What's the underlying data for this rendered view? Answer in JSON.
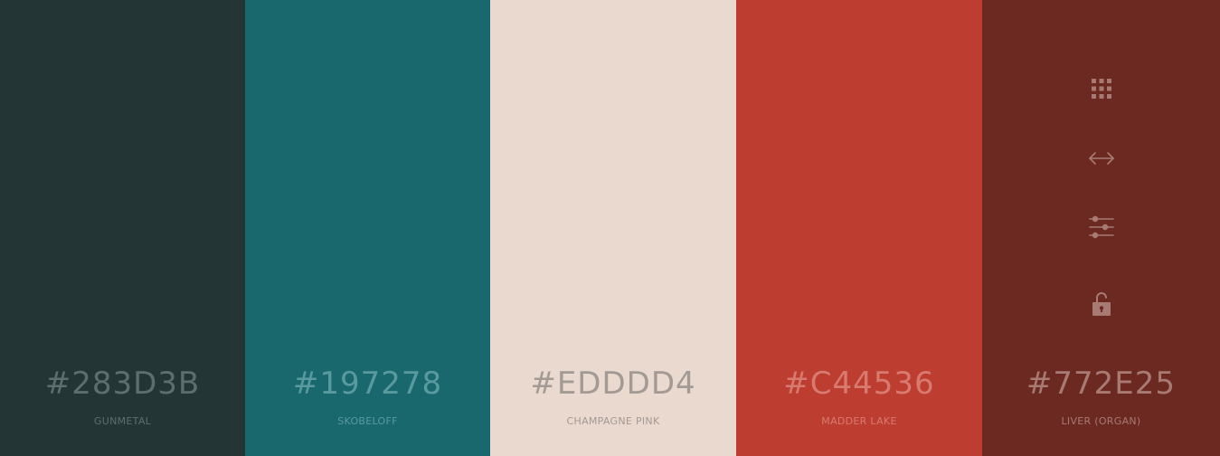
{
  "swatches": [
    {
      "hex": "#283D3B",
      "name": "GUNMETAL",
      "bg": "#233635",
      "text_color": "#5e6e6c"
    },
    {
      "hex": "#197278",
      "name": "SKOBELOFF",
      "bg": "#18686d",
      "text_color": "#5a9a9e"
    },
    {
      "hex": "#EDDDD4",
      "name": "CHAMPAGNE PINK",
      "bg": "#e9d9cf",
      "text_color": "#a39a94"
    },
    {
      "hex": "#C44536",
      "name": "MADDER LAKE",
      "bg": "#bd3e31",
      "text_color": "#d77b70"
    },
    {
      "hex": "#772E25",
      "name": "LIVER (ORGAN)",
      "bg": "#6b2922",
      "text_color": "#a87a74"
    }
  ],
  "tools": {
    "icon_color": "#a87a74",
    "icons": [
      "grid-icon",
      "resize-arrows-icon",
      "sliders-icon",
      "unlock-icon"
    ]
  }
}
